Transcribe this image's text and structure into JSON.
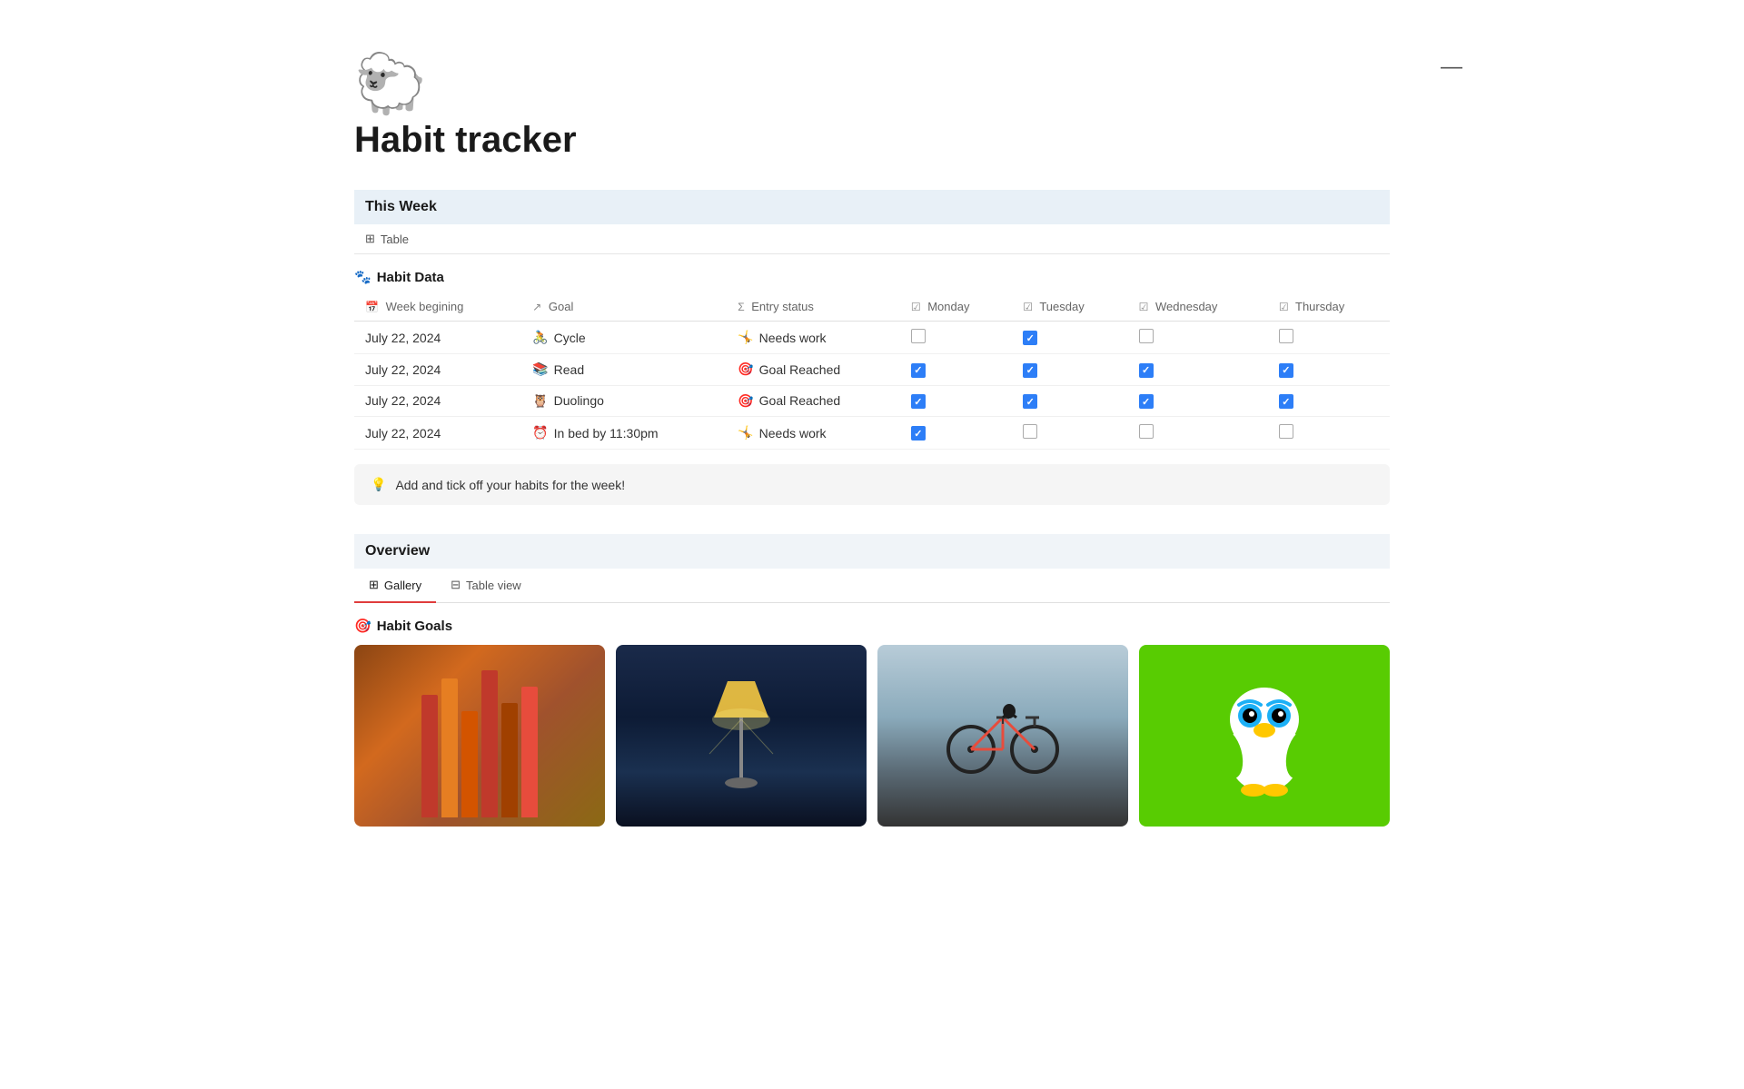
{
  "page": {
    "icon": "🐑",
    "title": "Habit tracker",
    "minimize_label": "—"
  },
  "this_week": {
    "section_title": "This Week",
    "view_icon": "⊞",
    "view_label": "Table"
  },
  "habit_data": {
    "header_icon": "🐾",
    "header_label": "Habit Data",
    "columns": [
      {
        "icon": "📅",
        "icon_type": "calendar",
        "label": "Week begining"
      },
      {
        "icon": "↗",
        "icon_type": "arrow",
        "label": "Goal"
      },
      {
        "icon": "Σ",
        "icon_type": "sigma",
        "label": "Entry status"
      },
      {
        "icon": "☑",
        "icon_type": "check",
        "label": "Monday"
      },
      {
        "icon": "☑",
        "icon_type": "check",
        "label": "Tuesday"
      },
      {
        "icon": "☑",
        "icon_type": "check",
        "label": "Wednesday"
      },
      {
        "icon": "☑",
        "icon_type": "check",
        "label": "Thursday"
      }
    ],
    "rows": [
      {
        "date": "July 22, 2024",
        "goal_icon": "🚴",
        "goal": "Cycle",
        "status_icon": "🤸",
        "status": "Needs work",
        "monday": false,
        "tuesday": true,
        "wednesday": false,
        "thursday": false
      },
      {
        "date": "July 22, 2024",
        "goal_icon": "📚",
        "goal": "Read",
        "status_icon": "🎯",
        "status": "Goal Reached",
        "monday": true,
        "tuesday": true,
        "wednesday": true,
        "thursday": true
      },
      {
        "date": "July 22, 2024",
        "goal_icon": "🦉",
        "goal": "Duolingo",
        "status_icon": "🎯",
        "status": "Goal Reached",
        "monday": true,
        "tuesday": true,
        "wednesday": true,
        "thursday": true
      },
      {
        "date": "July 22, 2024",
        "goal_icon": "⏰",
        "goal": "In bed by 11:30pm",
        "status_icon": "🤸",
        "status": "Needs work",
        "monday": true,
        "tuesday": false,
        "wednesday": false,
        "thursday": false
      }
    ]
  },
  "callout": {
    "icon": "💡",
    "text": "Add and tick off your habits for the week!"
  },
  "overview": {
    "section_title": "Overview",
    "tabs": [
      {
        "icon": "⊞",
        "label": "Gallery",
        "active": true
      },
      {
        "icon": "⊟",
        "label": "Table view",
        "active": false
      }
    ],
    "habit_goals_icon": "🎯",
    "habit_goals_label": "Habit Goals",
    "cards": [
      {
        "type": "books",
        "color": "#8B4513"
      },
      {
        "type": "lamp",
        "color": "#1a2a4a"
      },
      {
        "type": "bike",
        "color": "#607080"
      },
      {
        "type": "duolingo",
        "color": "#58cc02"
      }
    ]
  }
}
